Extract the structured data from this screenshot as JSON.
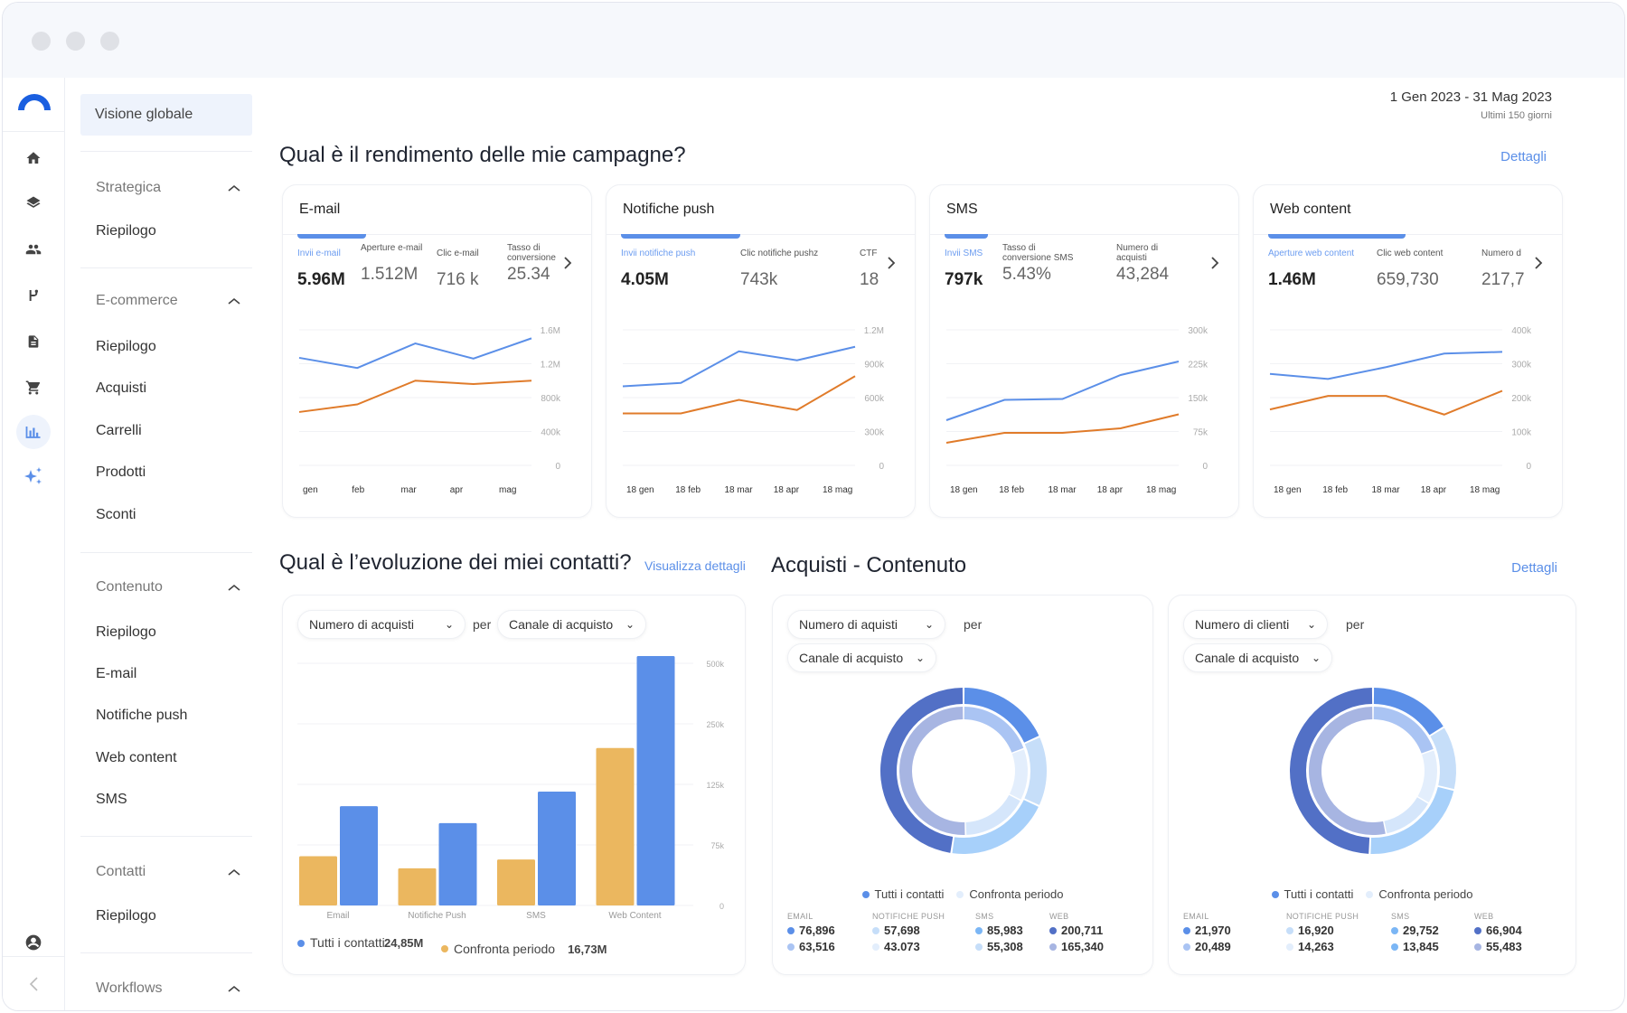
{
  "window": {
    "controls": [
      "close",
      "minimize",
      "maximize"
    ]
  },
  "rail": {
    "icons": [
      "home-icon",
      "layers-icon",
      "contacts-icon",
      "automation-icon",
      "document-icon",
      "cart-icon",
      "analytics-icon",
      "sparkles-icon"
    ],
    "active": "analytics-icon",
    "bottom_icons": [
      "account-icon",
      "collapse-icon"
    ]
  },
  "sidebar": {
    "top_item": "Visione globale",
    "groups": [
      {
        "label": "Strategica",
        "items": [
          "Riepilogo"
        ]
      },
      {
        "label": "E-commerce",
        "items": [
          "Riepilogo",
          "Acquisti",
          "Carrelli",
          "Prodotti",
          "Sconti"
        ]
      },
      {
        "label": "Contenuto",
        "items": [
          "Riepilogo",
          "E-mail",
          "Notifiche push",
          "Web content",
          "SMS"
        ]
      },
      {
        "label": "Contatti",
        "items": [
          "Riepilogo"
        ]
      },
      {
        "label": "Workflows",
        "items": []
      }
    ]
  },
  "header": {
    "date_range": "1 Gen 2023 - 31 Mag 2023",
    "date_sub": "Ultimi 150 giorni"
  },
  "campaigns": {
    "title": "Qual è il rendimento delle mie campagne?",
    "details_link": "Dettagli",
    "cards": [
      {
        "title": "E-mail",
        "metrics": [
          {
            "label": "Invii e-mail",
            "value": "5.96M",
            "selected": true
          },
          {
            "label": "Aperture e-mail",
            "value": "1.512M"
          },
          {
            "label": "Clic e-mail",
            "value": "716 k"
          },
          {
            "label": "Tasso di conversione",
            "value": "25.34"
          }
        ]
      },
      {
        "title": "Notifiche push",
        "metrics": [
          {
            "label": "Invii notifiche push",
            "value": "4.05M",
            "selected": true
          },
          {
            "label": "Clic notifiche pushz",
            "value": "743k"
          },
          {
            "label": "CTF",
            "value": "18"
          }
        ]
      },
      {
        "title": "SMS",
        "metrics": [
          {
            "label": "Invii SMS",
            "value": "797k",
            "selected": true
          },
          {
            "label": "Tasso di conversione SMS",
            "value": "5.43%"
          },
          {
            "label": "Numero di acquisti",
            "value": "43,284"
          }
        ]
      },
      {
        "title": "Web content",
        "metrics": [
          {
            "label": "Aperture web content",
            "value": "1.46M",
            "selected": true
          },
          {
            "label": "Clic web content",
            "value": "659,730"
          },
          {
            "label": "Numero d",
            "value": "217,7"
          }
        ]
      }
    ]
  },
  "contacts": {
    "title": "Qual è l’evoluzione dei miei contatti?",
    "details_link": "Visualizza dettagli",
    "metric_select": "Numero di acquisti",
    "per_label": "per",
    "dimension_select": "Canale di acquisto",
    "legend": [
      {
        "label": "Tutti i contatti",
        "total": "24,85M",
        "color": "#5b8fe8"
      },
      {
        "label": "Confronta periodo",
        "total": "16,73M",
        "color": "#ebb75f"
      }
    ]
  },
  "purchases": {
    "title": "Acquisti - Contenuto",
    "details_link": "Dettagli",
    "per_label": "per",
    "legend_all": "Tutti i contatti",
    "legend_compare": "Confronta periodo",
    "panels": [
      {
        "metric_select": "Numero di aquisti",
        "dimension_select": "Canale di acquisto",
        "stats": [
          {
            "header": "EMAIL",
            "current": "76,896",
            "compare": "63,516",
            "c1": "#5b8fe8",
            "c2": "#aac4f3"
          },
          {
            "header": "NOTIFICHE PUSH",
            "current": "57,698",
            "compare": "43.073",
            "c1": "#c6def9",
            "c2": "#e3eefc"
          },
          {
            "header": "SMS",
            "current": "85,983",
            "compare": "55,308",
            "c1": "#7bb6f5",
            "c2": "#c6def9"
          },
          {
            "header": "WEB",
            "current": "200,711",
            "compare": "165,340",
            "c1": "#5270c6",
            "c2": "#a7b5e2"
          }
        ]
      },
      {
        "metric_select": "Numero di clienti",
        "dimension_select": "Canale di acquisto",
        "stats": [
          {
            "header": "EMAIL",
            "current": "21,970",
            "compare": "20,489",
            "c1": "#5b8fe8",
            "c2": "#aac4f3"
          },
          {
            "header": "NOTIFICHE PUSH",
            "current": "16,920",
            "compare": "14,263",
            "c1": "#c6def9",
            "c2": "#e3eefc"
          },
          {
            "header": "SMS",
            "current": "29,752",
            "compare": "13,845",
            "c1": "#7bb6f5",
            "c2": "#7bb6f5"
          },
          {
            "header": "WEB",
            "current": "66,904",
            "compare": "55,483",
            "c1": "#5270c6",
            "c2": "#a7b5e2"
          }
        ]
      }
    ]
  },
  "colors": {
    "accent": "#5b8fe8",
    "orange_line": "#e07b2a",
    "bar_compare": "#ebb75f"
  },
  "chart_data": [
    {
      "type": "line",
      "title": "E-mail",
      "x": [
        "gen",
        "feb",
        "mar",
        "apr",
        "mag"
      ],
      "yticks": [
        "0",
        "400k",
        "800k",
        "1.2M",
        "1.6M"
      ],
      "ylim": [
        0,
        1600000
      ],
      "series": [
        {
          "name": "Tutti i contatti",
          "color": "#5b8fe8",
          "values": [
            1270000,
            1150000,
            1440000,
            1260000,
            1500000
          ]
        },
        {
          "name": "Confronta periodo",
          "color": "#e07b2a",
          "values": [
            630000,
            720000,
            1000000,
            960000,
            1000000
          ]
        }
      ]
    },
    {
      "type": "line",
      "title": "Notifiche push",
      "x": [
        "18 gen",
        "18 feb",
        "18 mar",
        "18 apr",
        "18 mag"
      ],
      "yticks": [
        "0",
        "300k",
        "600k",
        "900k",
        "1.2M"
      ],
      "ylim": [
        0,
        1200000
      ],
      "series": [
        {
          "name": "Tutti i contatti",
          "color": "#5b8fe8",
          "values": [
            700000,
            730000,
            1010000,
            930000,
            1050000
          ]
        },
        {
          "name": "Confronta periodo",
          "color": "#e07b2a",
          "values": [
            460000,
            460000,
            580000,
            490000,
            790000
          ]
        }
      ]
    },
    {
      "type": "line",
      "title": "SMS",
      "x": [
        "18 gen",
        "18 feb",
        "18 mar",
        "18 apr",
        "18 mag"
      ],
      "yticks": [
        "0",
        "75k",
        "150k",
        "225k",
        "300k"
      ],
      "ylim": [
        0,
        300000
      ],
      "series": [
        {
          "name": "Tutti i contatti",
          "color": "#5b8fe8",
          "values": [
            100000,
            145000,
            147000,
            200000,
            230000
          ]
        },
        {
          "name": "Confronta periodo",
          "color": "#e07b2a",
          "values": [
            50000,
            72000,
            72000,
            82000,
            113000
          ]
        }
      ]
    },
    {
      "type": "line",
      "title": "Web content",
      "x": [
        "18 gen",
        "18 feb",
        "18 mar",
        "18 apr",
        "18 mag"
      ],
      "yticks": [
        "0",
        "100k",
        "200k",
        "300k",
        "400k"
      ],
      "ylim": [
        0,
        400000
      ],
      "series": [
        {
          "name": "Tutti i contatti",
          "color": "#5b8fe8",
          "values": [
            270000,
            255000,
            290000,
            330000,
            335000
          ]
        },
        {
          "name": "Confronta periodo",
          "color": "#e07b2a",
          "values": [
            165000,
            205000,
            205000,
            150000,
            220000
          ]
        }
      ]
    },
    {
      "type": "bar",
      "title": "Numero di acquisti per Canale di acquisto",
      "categories": [
        "Email",
        "Notifiche Push",
        "SMS",
        "Web Content"
      ],
      "yticks": [
        "0",
        "75k",
        "125k",
        "250k",
        "500k"
      ],
      "ytick_values": [
        0,
        75000,
        125000,
        250000,
        500000
      ],
      "series": [
        {
          "name": "Confronta periodo",
          "color": "#ebb75f",
          "values": [
            61000,
            46000,
            57000,
            200000
          ]
        },
        {
          "name": "Tutti i contatti",
          "color": "#5b8fe8",
          "values": [
            107000,
            93000,
            119000,
            540000
          ]
        }
      ]
    },
    {
      "type": "pie",
      "title": "Numero di aquisti per Canale di acquisto",
      "categories": [
        "EMAIL",
        "NOTIFICHE PUSH",
        "SMS",
        "WEB"
      ],
      "series": [
        {
          "name": "Tutti i contatti",
          "values": [
            76896,
            57698,
            85983,
            200711
          ],
          "colors": [
            "#5b8fe8",
            "#c6def9",
            "#a7d0fa",
            "#5270c6"
          ]
        },
        {
          "name": "Confronta periodo",
          "values": [
            63516,
            43073,
            55308,
            165340
          ],
          "colors": [
            "#aac4f3",
            "#e3eefc",
            "#d5e6fb",
            "#a7b5e2"
          ]
        }
      ]
    },
    {
      "type": "pie",
      "title": "Numero di clienti per Canale di acquisto",
      "categories": [
        "EMAIL",
        "NOTIFICHE PUSH",
        "SMS",
        "WEB"
      ],
      "series": [
        {
          "name": "Tutti i contatti",
          "values": [
            21970,
            16920,
            29752,
            66904
          ],
          "colors": [
            "#5b8fe8",
            "#c6def9",
            "#a7d0fa",
            "#5270c6"
          ]
        },
        {
          "name": "Confronta periodo",
          "values": [
            20489,
            14263,
            13845,
            55483
          ],
          "colors": [
            "#aac4f3",
            "#e3eefc",
            "#d5e6fb",
            "#a7b5e2"
          ]
        }
      ]
    }
  ]
}
